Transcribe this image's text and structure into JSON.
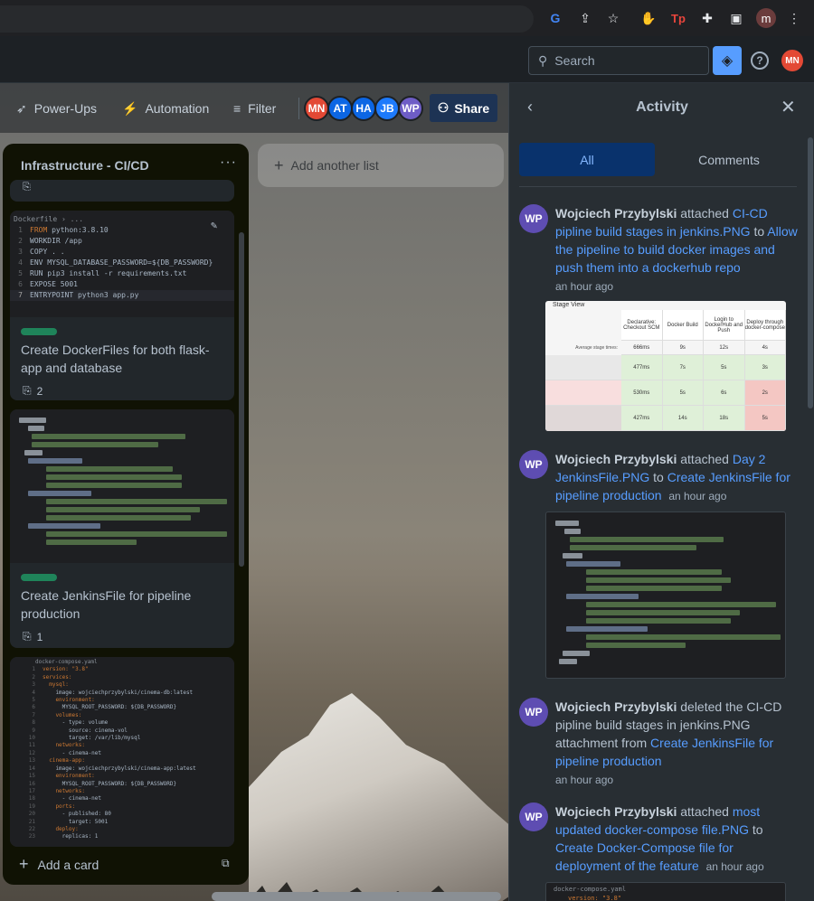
{
  "browser": {
    "profile_initial": "m",
    "extensions": [
      "google-icon",
      "share-icon",
      "star-icon",
      "hand-extension-icon",
      "tp-extension-icon",
      "puzzle-icon",
      "sidebar-icon"
    ]
  },
  "topbar": {
    "search_placeholder": "Search",
    "user_initials": "MN"
  },
  "board_header": {
    "powerups_label": "Power-Ups",
    "automation_label": "Automation",
    "filter_label": "Filter",
    "share_label": "Share",
    "members": [
      {
        "initials": "MN",
        "color": "#e34935"
      },
      {
        "initials": "AT",
        "color": "#0c66e4"
      },
      {
        "initials": "HA",
        "color": "#0c66e4"
      },
      {
        "initials": "JB",
        "color": "#1d7afc"
      },
      {
        "initials": "WP",
        "color": "#6e5dc6"
      }
    ]
  },
  "list": {
    "title": "Infrastructure - CI/CD",
    "menu": "···",
    "add_card_label": "Add a card",
    "cards": [
      {
        "code_header": "Dockerfile › ...",
        "code_lines": [
          "FROM python:3.8.10",
          "WORKDIR /app",
          "COPY . .",
          "ENV MYSQL_DATABASE_PASSWORD=${DB_PASSWORD}",
          "RUN pip3 install -r requirements.txt",
          "EXPOSE 5001",
          "ENTRYPOINT python3 app.py"
        ],
        "title": "Create DockerFiles for both flask-app and database",
        "attachments": "2"
      },
      {
        "title": "Create JenkinsFile for pipeline production",
        "attachments": "1"
      },
      {
        "code_header": "docker-compose.yaml",
        "code_lines": [
          "version: \"3.8\"",
          "services:",
          "  mysql:",
          "    image: wojciechprzybylski/cinema-db:latest",
          "    environment:",
          "      MYSQL_ROOT_PASSWORD: ${DB_PASSWORD}",
          "    volumes:",
          "      - type: volume",
          "        source: cinema-vol",
          "        target: /var/lib/mysql",
          "    networks:",
          "      - cinema-net",
          "  cinema-app:",
          "    image: wojciechprzybylski/cinema-app:latest",
          "    environment:",
          "      MYSQL_ROOT_PASSWORD: ${DB_PASSWORD}",
          "    networks:",
          "      - cinema-net",
          "    ports:",
          "      - published: 80",
          "        target: 5001",
          "    deploy:",
          "      replicas: 1"
        ]
      }
    ]
  },
  "add_list_label": "Add another list",
  "activity": {
    "title": "Activity",
    "tabs": {
      "all": "All",
      "comments": "Comments"
    },
    "items": [
      {
        "initials": "WP",
        "user": "Wojciech Przybylski",
        "action": " attached ",
        "link1": "CI-CD pipline build stages in jenkins.PNG",
        "mid": " to ",
        "link2": "Allow the pipeline to build docker images and push them into a dockerhub repo",
        "time": "an hour ago"
      },
      {
        "initials": "WP",
        "user": "Wojciech Przybylski",
        "action": " attached ",
        "link1": "Day 2 JenkinsFile.PNG",
        "mid": " to ",
        "link2": "Create JenkinsFile for pipeline production",
        "time": "an hour ago"
      },
      {
        "initials": "WP",
        "user": "Wojciech Przybylski",
        "action": " deleted the CI-CD pipline build stages in jenkins.PNG attachment from ",
        "link2": "Create JenkinsFile for pipeline production",
        "time": "an hour ago"
      },
      {
        "initials": "WP",
        "user": "Wojciech Przybylski",
        "action": " attached ",
        "link1": "most updated docker-compose file.PNG",
        "mid": " to ",
        "link2": "Create Docker-Compose file for deployment of the feature",
        "time": "an hour ago"
      }
    ],
    "jenkins_stage_view": {
      "label": "Stage View",
      "headers": [
        "Declarative: Checkout SCM",
        "Docker Build",
        "Login to DockerHub and Push",
        "Deploy through docker-compose"
      ],
      "avg_label": "Average stage times:",
      "avg_values": [
        "666ms",
        "9s",
        "12s",
        "4s"
      ],
      "rows": [
        {
          "values": [
            "477ms",
            "7s",
            "5s",
            "3s"
          ]
        },
        {
          "values": [
            "530ms",
            "5s",
            "6s",
            "2s"
          ]
        },
        {
          "values": [
            "427ms",
            "14s",
            "18s",
            "5s"
          ]
        }
      ]
    },
    "last_attachment_header": "docker-compose.yaml",
    "last_attachment_line": "version: \"3.8\""
  }
}
